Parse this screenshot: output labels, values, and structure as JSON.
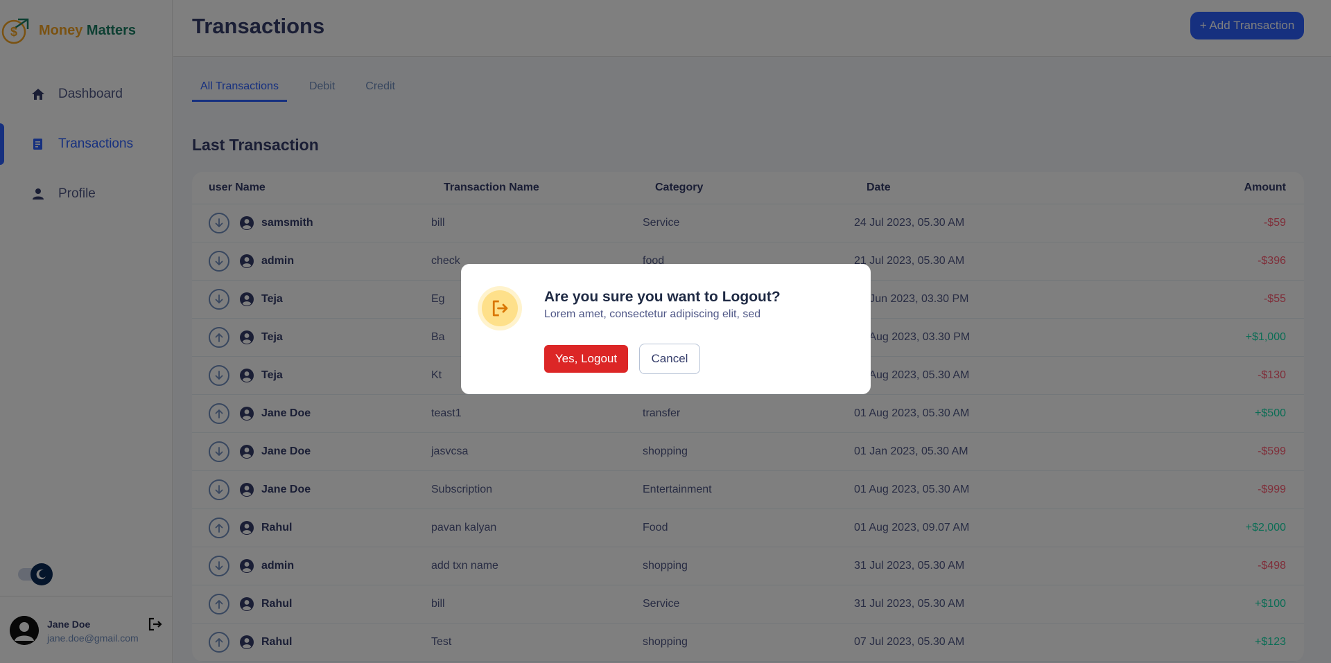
{
  "brand": {
    "word1": "Money",
    "word2": "Matters"
  },
  "sidebar": {
    "items": [
      {
        "label": "Dashboard",
        "icon": "home-icon"
      },
      {
        "label": "Transactions",
        "icon": "document-icon"
      },
      {
        "label": "Profile",
        "icon": "person-icon"
      }
    ],
    "active": "Transactions"
  },
  "user": {
    "name": "Jane Doe",
    "email": "jane.doe@gmail.com"
  },
  "header": {
    "title": "Transactions",
    "add_button": "+ Add Transaction"
  },
  "tabs": [
    {
      "label": "All Transactions"
    },
    {
      "label": "Debit"
    },
    {
      "label": "Credit"
    }
  ],
  "active_tab": "All Transactions",
  "section_title": "Last Transaction",
  "table": {
    "headers": [
      "user Name",
      "Transaction Name",
      "Category",
      "Date",
      "Amount"
    ],
    "rows": [
      {
        "dir": "down",
        "user": "samsmith",
        "name": "bill",
        "category": "Service",
        "date": "24 Jul 2023, 05.30 AM",
        "amount": "-$59"
      },
      {
        "dir": "down",
        "user": "admin",
        "name": "check",
        "category": "food",
        "date": "21 Jul 2023, 05.30 AM",
        "amount": "-$396"
      },
      {
        "dir": "down",
        "user": "Teja",
        "name": "Eg",
        "category": "",
        "date": "28 Jun 2023, 03.30 PM",
        "amount": "-$55"
      },
      {
        "dir": "up",
        "user": "Teja",
        "name": "Ba",
        "category": "",
        "date": "09 Aug 2023, 03.30 PM",
        "amount": "+$1,000"
      },
      {
        "dir": "down",
        "user": "Teja",
        "name": "Kt",
        "category": "",
        "date": "01 Aug 2023, 05.30 AM",
        "amount": "-$130"
      },
      {
        "dir": "up",
        "user": "Jane Doe",
        "name": "teast1",
        "category": "transfer",
        "date": "01 Aug 2023, 05.30 AM",
        "amount": "+$500"
      },
      {
        "dir": "down",
        "user": "Jane Doe",
        "name": "jasvcsa",
        "category": "shopping",
        "date": "01 Jan 2023, 05.30 AM",
        "amount": "-$599"
      },
      {
        "dir": "down",
        "user": "Jane Doe",
        "name": "Subscription",
        "category": "Entertainment",
        "date": "01 Aug 2023, 05.30 AM",
        "amount": "-$999"
      },
      {
        "dir": "up",
        "user": "Rahul",
        "name": "pavan kalyan",
        "category": "Food",
        "date": "01 Aug 2023, 09.07 AM",
        "amount": "+$2,000"
      },
      {
        "dir": "down",
        "user": "admin",
        "name": "add txn name",
        "category": "shopping",
        "date": "31 Jul 2023, 05.30 AM",
        "amount": "-$498"
      },
      {
        "dir": "up",
        "user": "Rahul",
        "name": "bill",
        "category": "Service",
        "date": "31 Jul 2023, 05.30 AM",
        "amount": "+$100"
      },
      {
        "dir": "up",
        "user": "Rahul",
        "name": "Test",
        "category": "shopping",
        "date": "07 Jul 2023, 05.30 AM",
        "amount": "+$123"
      }
    ]
  },
  "modal": {
    "title": "Are you sure you want to Logout?",
    "subtitle": "Lorem amet, consectetur adipiscing elit, sed",
    "confirm": "Yes, Logout",
    "cancel": "Cancel",
    "icon": "logout-icon"
  },
  "colors": {
    "accent": "#2d60ff",
    "debit": "#fe5c73",
    "credit": "#16dbaa",
    "danger": "#dc2626"
  }
}
